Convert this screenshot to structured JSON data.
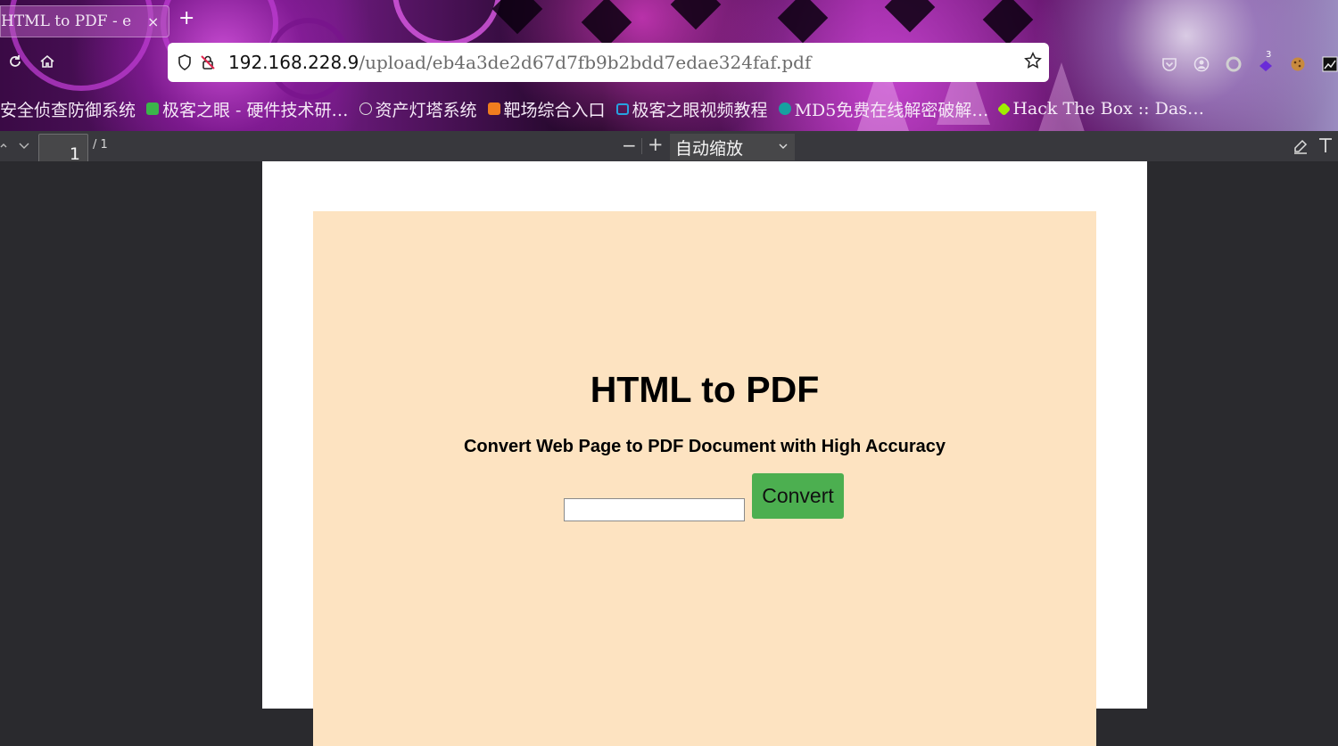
{
  "browser": {
    "tab_title": "HTML to PDF - e",
    "new_tab": "+",
    "close": "×",
    "url_host": "192.168.228.9",
    "url_path": "/upload/eb4a3de2d67d7fb9b2bdd7edae324faf.pdf",
    "extension_badge": "3"
  },
  "bookmarks": [
    {
      "label": "安全侦查防御系统",
      "icon": "none"
    },
    {
      "label": "极客之眼 - 硬件技术研…",
      "icon": "green-app-icon",
      "color": "#3bb54a"
    },
    {
      "label": "资产灯塔系统",
      "icon": "globe-icon",
      "color": "#cccccc"
    },
    {
      "label": "靶场综合入口",
      "icon": "orange-app-icon",
      "color": "#f07d1e"
    },
    {
      "label": "极客之眼视频教程",
      "icon": "tv-icon",
      "color": "#27a2e0"
    },
    {
      "label": "MD5免费在线解密破解…",
      "icon": "teal-gear-icon",
      "color": "#16a0a0"
    },
    {
      "label": "Hack The Box :: Das…",
      "icon": "cube-icon",
      "color": "#9fef00"
    }
  ],
  "pdf_toolbar": {
    "page_number": "1",
    "page_total": "/ 1",
    "zoom_out": "−",
    "zoom_in": "+",
    "zoom_value": "自动缩放"
  },
  "document": {
    "title": "HTML to PDF",
    "subtitle": "Convert Web Page to PDF Document with High Accuracy",
    "input_value": "",
    "button_label": "Convert",
    "background_color": "#fde3c1",
    "button_color": "#4caf50"
  }
}
